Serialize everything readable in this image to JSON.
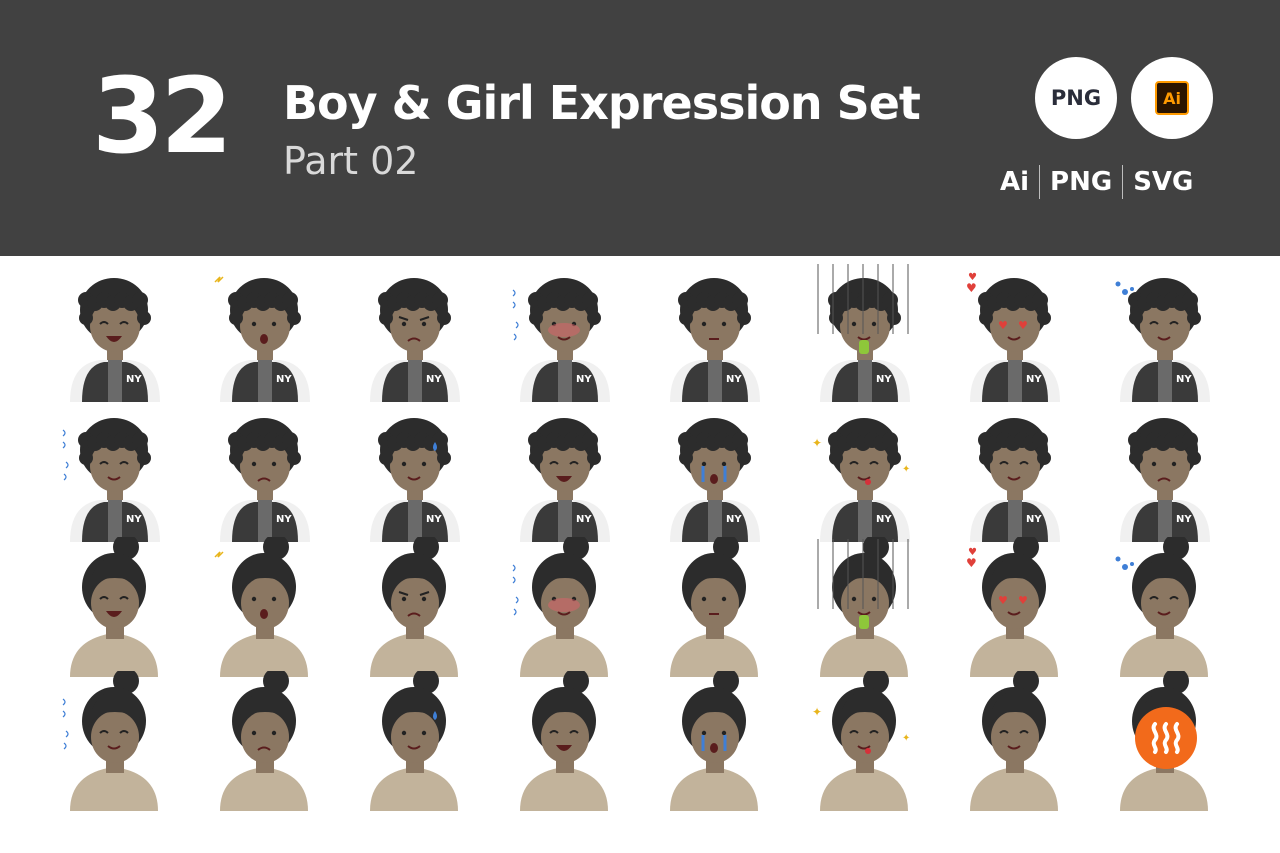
{
  "header": {
    "count": "32",
    "title": "Boy & Girl Expression Set",
    "subtitle": "Part 02",
    "badge_png": "PNG",
    "badge_ai": "Ai",
    "formats": [
      "Ai",
      "PNG",
      "SVG"
    ]
  },
  "colors": {
    "banner": "#414141",
    "skin": "#8b7762",
    "hair": "#2c2c2c",
    "jacket": "#3a3a3a",
    "sleeve": "#f0f0f0",
    "top": "#c2b39b",
    "brand": "#f26a1b"
  },
  "grid": {
    "rows": [
      {
        "character": "boy",
        "expressions": [
          "laughing",
          "surprised",
          "angry",
          "embarrassed",
          "neutral",
          "sick",
          "in-love",
          "sleepy"
        ]
      },
      {
        "character": "boy",
        "expressions": [
          "nervous",
          "sad",
          "sweating",
          "grinning",
          "crying",
          "playful",
          "smiling",
          "worried"
        ]
      },
      {
        "character": "girl",
        "expressions": [
          "laughing",
          "surprised",
          "angry",
          "embarrassed",
          "neutral",
          "sick",
          "in-love",
          "sleepy"
        ]
      },
      {
        "character": "girl",
        "expressions": [
          "nervous",
          "sad",
          "sweating",
          "grinning",
          "crying",
          "playful",
          "smiling",
          "brand"
        ]
      }
    ]
  }
}
